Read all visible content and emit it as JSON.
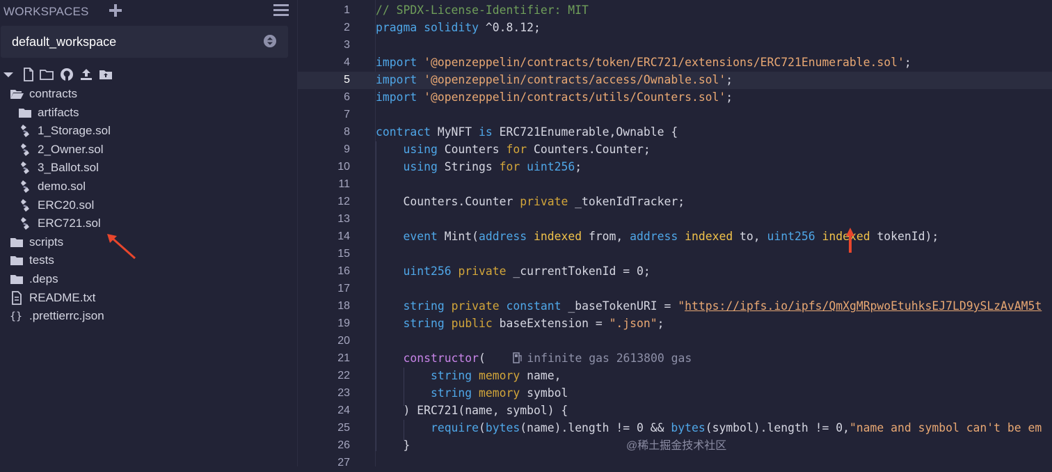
{
  "sidebar": {
    "title": "WORKSPACES",
    "workspace": "default_workspace",
    "tree": [
      {
        "label": "contracts",
        "type": "folder-open",
        "depth": 0
      },
      {
        "label": "artifacts",
        "type": "folder",
        "depth": 1
      },
      {
        "label": "1_Storage.sol",
        "type": "sol",
        "depth": 1
      },
      {
        "label": "2_Owner.sol",
        "type": "sol",
        "depth": 1
      },
      {
        "label": "3_Ballot.sol",
        "type": "sol",
        "depth": 1
      },
      {
        "label": "demo.sol",
        "type": "sol",
        "depth": 1
      },
      {
        "label": "ERC20.sol",
        "type": "sol",
        "depth": 1
      },
      {
        "label": "ERC721.sol",
        "type": "sol",
        "depth": 1
      },
      {
        "label": "scripts",
        "type": "folder",
        "depth": 0
      },
      {
        "label": "tests",
        "type": "folder",
        "depth": 0
      },
      {
        "label": ".deps",
        "type": "folder",
        "depth": 0
      },
      {
        "label": "README.txt",
        "type": "file",
        "depth": 0
      },
      {
        "label": ".prettierrc.json",
        "type": "json",
        "depth": 0
      }
    ],
    "toolbar_icons": [
      "caret-down-icon",
      "new-file-icon",
      "new-folder-icon",
      "github-icon",
      "upload-icon",
      "import-folder-icon"
    ]
  },
  "editor": {
    "active_line": 5,
    "lines": [
      [
        [
          "// SPDX-License-Identifier: MIT",
          "c-com"
        ]
      ],
      [
        [
          "pragma solidity",
          "c-kw"
        ],
        [
          " ^0.8.12;",
          ""
        ]
      ],
      [],
      [
        [
          "import",
          "c-kw"
        ],
        [
          " ",
          ""
        ],
        [
          "'@openzeppelin/contracts/token/ERC721/extensions/ERC721Enumerable.sol'",
          "c-str"
        ],
        [
          ";",
          ""
        ]
      ],
      [
        [
          "import",
          "c-kw"
        ],
        [
          " ",
          ""
        ],
        [
          "'@openzeppelin/contracts/access/Ownable.sol'",
          "c-str"
        ],
        [
          ";",
          ""
        ]
      ],
      [
        [
          "import",
          "c-kw"
        ],
        [
          " ",
          ""
        ],
        [
          "'@openzeppelin/contracts/utils/Counters.sol'",
          "c-str"
        ],
        [
          ";",
          ""
        ]
      ],
      [],
      [
        [
          "contract",
          "c-kw"
        ],
        [
          " MyNFT ",
          ""
        ],
        [
          "is",
          "c-kw"
        ],
        [
          " ERC721Enumerable,Ownable {",
          ""
        ]
      ],
      [
        [
          "    ",
          ""
        ],
        [
          "using",
          "c-kw"
        ],
        [
          " Counters ",
          ""
        ],
        [
          "for",
          "c-kw2"
        ],
        [
          " Counters.Counter;",
          ""
        ]
      ],
      [
        [
          "    ",
          ""
        ],
        [
          "using",
          "c-kw"
        ],
        [
          " Strings ",
          ""
        ],
        [
          "for",
          "c-kw2"
        ],
        [
          " ",
          ""
        ],
        [
          "uint256",
          "c-kw"
        ],
        [
          ";",
          ""
        ]
      ],
      [],
      [
        [
          "    Counters.Counter ",
          ""
        ],
        [
          "private",
          "c-kw2"
        ],
        [
          " _tokenIdTracker;",
          ""
        ]
      ],
      [],
      [
        [
          "    ",
          ""
        ],
        [
          "event",
          "c-kw"
        ],
        [
          " Mint(",
          ""
        ],
        [
          "address",
          "c-kw"
        ],
        [
          " ",
          ""
        ],
        [
          "indexed",
          "c-yel"
        ],
        [
          " from, ",
          ""
        ],
        [
          "address",
          "c-kw"
        ],
        [
          " ",
          ""
        ],
        [
          "indexed",
          "c-yel"
        ],
        [
          " to, ",
          ""
        ],
        [
          "uint256",
          "c-kw"
        ],
        [
          " ",
          ""
        ],
        [
          "indexed",
          "c-yel"
        ],
        [
          " tokenId);",
          ""
        ]
      ],
      [],
      [
        [
          "    ",
          ""
        ],
        [
          "uint256",
          "c-kw"
        ],
        [
          " ",
          ""
        ],
        [
          "private",
          "c-kw2"
        ],
        [
          " _currentTokenId = 0;",
          ""
        ]
      ],
      [],
      [
        [
          "    ",
          ""
        ],
        [
          "string",
          "c-kw"
        ],
        [
          " ",
          ""
        ],
        [
          "private",
          "c-kw2"
        ],
        [
          " ",
          ""
        ],
        [
          "constant",
          "c-kw"
        ],
        [
          " _baseTokenURI = ",
          ""
        ],
        [
          "\"",
          "c-str"
        ],
        [
          "https://ipfs.io/ipfs/QmXgMRpwoEtuhksEJ7LD9ySLzAvAM5t",
          "c-url"
        ]
      ],
      [
        [
          "    ",
          ""
        ],
        [
          "string",
          "c-kw"
        ],
        [
          " ",
          ""
        ],
        [
          "public",
          "c-kw2"
        ],
        [
          " baseExtension = ",
          ""
        ],
        [
          "\".json\"",
          "c-str"
        ],
        [
          ";",
          ""
        ]
      ],
      [],
      [
        [
          "    ",
          ""
        ],
        [
          "constructor",
          "c-pur"
        ],
        [
          "(",
          ""
        ],
        [
          "    ",
          ""
        ],
        [
          "GAS",
          "gas"
        ],
        [
          "infinite gas 2613800 gas",
          "c-gas"
        ]
      ],
      [
        [
          "        ",
          ""
        ],
        [
          "string",
          "c-kw"
        ],
        [
          " ",
          ""
        ],
        [
          "memory",
          "c-kw2"
        ],
        [
          " name,",
          ""
        ]
      ],
      [
        [
          "        ",
          ""
        ],
        [
          "string",
          "c-kw"
        ],
        [
          " ",
          ""
        ],
        [
          "memory",
          "c-kw2"
        ],
        [
          " symbol",
          ""
        ]
      ],
      [
        [
          "    ) ERC721(name, symbol) {",
          ""
        ]
      ],
      [
        [
          "        ",
          ""
        ],
        [
          "require",
          "c-kw"
        ],
        [
          "(",
          ""
        ],
        [
          "bytes",
          "c-kw"
        ],
        [
          "(name).length != 0 && ",
          ""
        ],
        [
          "bytes",
          "c-kw"
        ],
        [
          "(symbol).length != 0,",
          ""
        ],
        [
          "\"name and symbol can't be em",
          "c-str"
        ]
      ],
      [
        [
          "    }",
          ""
        ]
      ],
      []
    ]
  },
  "watermark": "@稀土掘金技术社区"
}
